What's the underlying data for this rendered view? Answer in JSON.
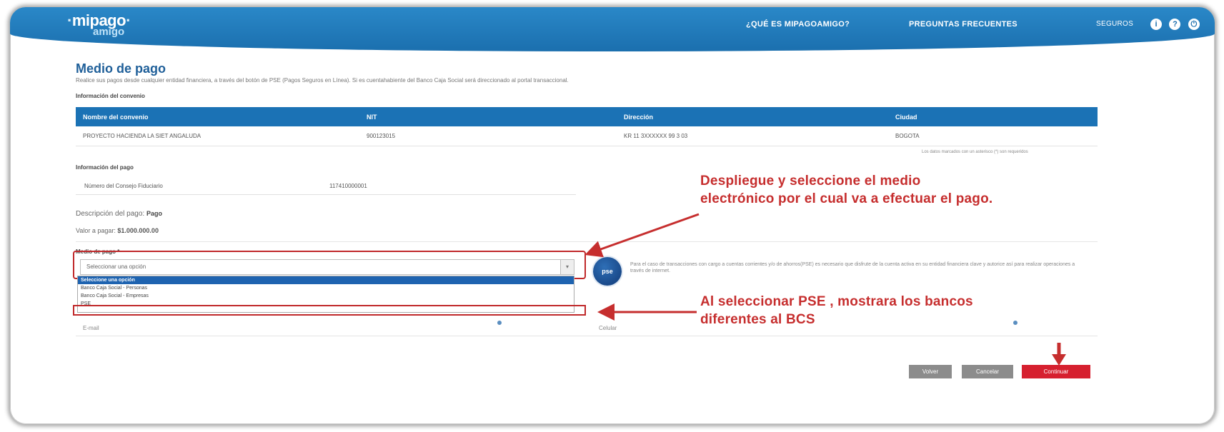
{
  "header": {
    "logo_line1": "mipago",
    "logo_line2": "amigo",
    "nav_que": "¿QUÉ ES MIPAGOAMIGO?",
    "nav_preguntas": "PREGUNTAS FRECUENTES",
    "user_label": "SEGUROS"
  },
  "page": {
    "title": "Medio de pago",
    "subtitle": "Realice sus pagos desde cualquier entidad financiera, a través del botón de PSE (Pagos Seguros en Línea). Si es cuentahabiente del Banco Caja Social será direccionado al portal transaccional."
  },
  "convenio": {
    "section_title": "Información del convenio",
    "headers": [
      "Nombre del convenio",
      "NIT",
      "Dirección",
      "Ciudad"
    ],
    "row": [
      "PROYECTO HACIENDA LA SIET ANGALUDA",
      "900123015",
      "KR 11 3XXXXXX 99 3 03",
      "BOGOTA"
    ],
    "note": "Los datos marcados con un asterisco (*) son requeridos"
  },
  "pago": {
    "section_title": "Información del pago",
    "label": "Número del Consejo Fiduciario",
    "value": "117410000001",
    "descripcion_label": "Descripción del pago:",
    "descripcion_value": "Pago",
    "valor_label": "Valor a pagar:",
    "valor_value": "$1.000.000.00"
  },
  "medio": {
    "label": "Medio de pago *",
    "placeholder": "Seleccionar una opción",
    "options": [
      "Seleccione una opción",
      "Banco Caja Social - Personas",
      "Banco Caja Social - Empresas",
      "PSE"
    ],
    "pse_logo": "pse",
    "pse_info": "Para el caso de transacciones con cargo a cuentas corrientes y/o de ahorros(PSE) es necesario que disfrute de la cuenta activa en su entidad financiera clave y autorice así para realizar operaciones a través de internet."
  },
  "under": {
    "left": "E-mail",
    "right": "Celular"
  },
  "annotations": {
    "a1_line1": "Despliegue y seleccione el medio",
    "a1_line2": "electrónico por el cual va a efectuar el pago.",
    "a2_line1": "Al seleccionar PSE , mostrara los bancos",
    "a2_line2": "diferentes al BCS"
  },
  "buttons": {
    "volver": "Volver",
    "cancelar": "Cancelar",
    "continuar": "Continuar"
  },
  "colors": {
    "header_blue": "#1b6fae",
    "table_blue": "#1b72b5",
    "annotation_red": "#c62e2e",
    "continue_red": "#d6202f"
  }
}
